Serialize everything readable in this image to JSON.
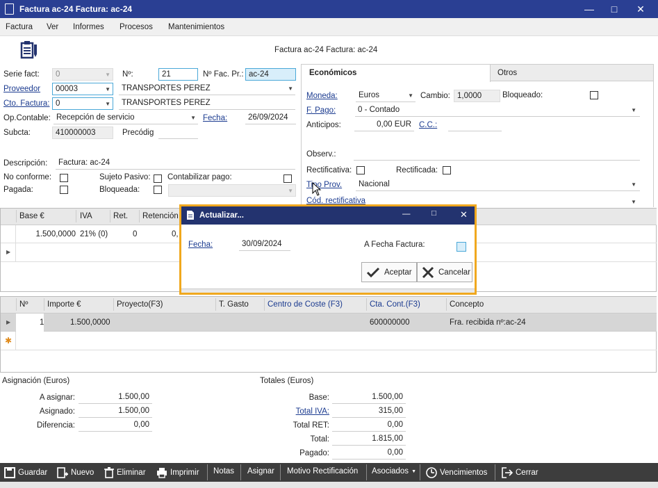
{
  "window": {
    "title": "Factura ac-24  Factura: ac-24"
  },
  "menu": [
    "Factura",
    "Ver",
    "Informes",
    "Procesos",
    "Mantenimientos"
  ],
  "header_title": "Factura ac-24  Factura: ac-24",
  "form": {
    "serie_label": "Serie fact:",
    "serie_value": "0",
    "num_label": "Nº:",
    "num_value": "21",
    "nfac_label": "Nº Fac. Pr.:",
    "nfac_value": "ac-24",
    "proveedor_label": "Proveedor",
    "proveedor_value": "00003",
    "proveedor_name": "TRANSPORTES PEREZ",
    "ctofactura_label": "Cto. Factura:",
    "ctofactura_value": "0",
    "ctofactura_name": "TRANSPORTES PEREZ",
    "opcontable_label": "Op.Contable:",
    "opcontable_value": "Recepción de servicio",
    "fecha_label": "Fecha:",
    "fecha_value": "26/09/2024",
    "subcta_label": "Subcta:",
    "subcta_value": "410000003",
    "precodig_label": "Precódig",
    "descripcion_label": "Descripción:",
    "descripcion_value": "Factura: ac-24",
    "noconforme_label": "No conforme:",
    "sujeto_label": "Sujeto Pasivo:",
    "contabilizar_label": "Contabilizar pago:",
    "pagada_label": "Pagada:",
    "bloqueada_label": "Bloqueada:"
  },
  "tabs": {
    "economicos": "Económicos",
    "otros": "Otros"
  },
  "econ": {
    "moneda_label": "Moneda:",
    "moneda_value": "Euros",
    "cambio_label": "Cambio:",
    "cambio_value": "1,0000",
    "bloqueado_label": "Bloqueado:",
    "fpago_label": "F. Pago:",
    "fpago_value": "0 - Contado",
    "anticipos_label": "Anticipos:",
    "anticipos_value": "0,00 EUR",
    "cc_label": "C.C.:",
    "observ_label": "Observ.:",
    "rectificativa_label": "Rectificativa:",
    "rectificada_label": "Rectificada:",
    "tipoprov_label": "Tipo Prov.",
    "tipoprov_value": "Nacional",
    "codrect_label": "Cód. rectificativa"
  },
  "grid1": {
    "headers": [
      "Base €",
      "IVA",
      "Ret.",
      "Retención"
    ],
    "row": [
      "1.500,0000",
      "21% (0)",
      "0",
      "0,"
    ]
  },
  "grid2": {
    "headers": [
      "Nº",
      "Importe €",
      "Proyecto(F3)",
      "T. Gasto",
      "Centro de Coste (F3)",
      "Cta. Cont.(F3)",
      "Concepto"
    ],
    "row": [
      "1",
      "1.500,0000",
      "",
      "",
      "",
      "600000000",
      "Fra. recibida nº:ac-24"
    ]
  },
  "asignacion": {
    "title": "Asignación (Euros)",
    "a_asignar_label": "A asignar:",
    "a_asignar_value": "1.500,00",
    "asignado_label": "Asignado:",
    "asignado_value": "1.500,00",
    "diferencia_label": "Diferencia:",
    "diferencia_value": "0,00"
  },
  "totales": {
    "title": "Totales (Euros)",
    "base_label": "Base:",
    "base_value": "1.500,00",
    "iva_label": "Total IVA:",
    "iva_value": "315,00",
    "ret_label": "Total RET:",
    "ret_value": "0,00",
    "total_label": "Total:",
    "total_value": "1.815,00",
    "pagado_label": "Pagado:",
    "pagado_value": "0,00"
  },
  "toolbar": {
    "guardar": "Guardar",
    "nuevo": "Nuevo",
    "eliminar": "Eliminar",
    "imprimir": "Imprimir",
    "notas": "Notas",
    "asignar": "Asignar",
    "motivo": "Motivo Rectificación",
    "asociados": "Asociados",
    "vencimientos": "Vencimientos",
    "cerrar": "Cerrar"
  },
  "dialog": {
    "title": "Actualizar...",
    "fecha_label": "Fecha:",
    "fecha_value": "30/09/2024",
    "afecha_label": "A Fecha Factura:",
    "aceptar": "Aceptar",
    "cancelar": "Cancelar"
  }
}
